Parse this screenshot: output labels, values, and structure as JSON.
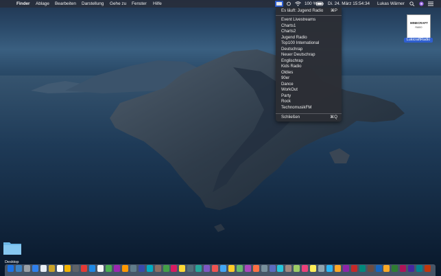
{
  "menubar": {
    "app_name": "Finder",
    "menus": [
      "Ablage",
      "Bearbeiten",
      "Darstellung",
      "Gehe zu",
      "Fenster",
      "Hilfe"
    ],
    "battery": "100 %",
    "datetime": "Di. 24. März  15:54:34",
    "user": "Lukas Wärner"
  },
  "dropdown": {
    "now_playing": "Es läuft: Jugend Radio",
    "now_playing_shortcut": "⌘P",
    "stations": [
      "Event Livestreams",
      "Charts1",
      "Charts2",
      "Jugend Radio",
      "Top100 International",
      "Deutschrap",
      "Neuer Deutschrap",
      "Englischrap",
      "Kids Radio",
      "Oldies",
      "90er",
      "Dance",
      "WorkOut",
      "Party",
      "Rock",
      "TechnomusikFM"
    ],
    "quit": "Schließen",
    "quit_shortcut": "⌘Q"
  },
  "desktop": {
    "app_label": "LukicraftRadio",
    "app_logo_text": "MINECRAFT",
    "app_logo_sub": "RADIO",
    "folder_label": "Desktop"
  },
  "colors": {
    "menubar": "#282e3a",
    "menu_bg": "#2c2e34",
    "selection": "#2f5fd0"
  }
}
